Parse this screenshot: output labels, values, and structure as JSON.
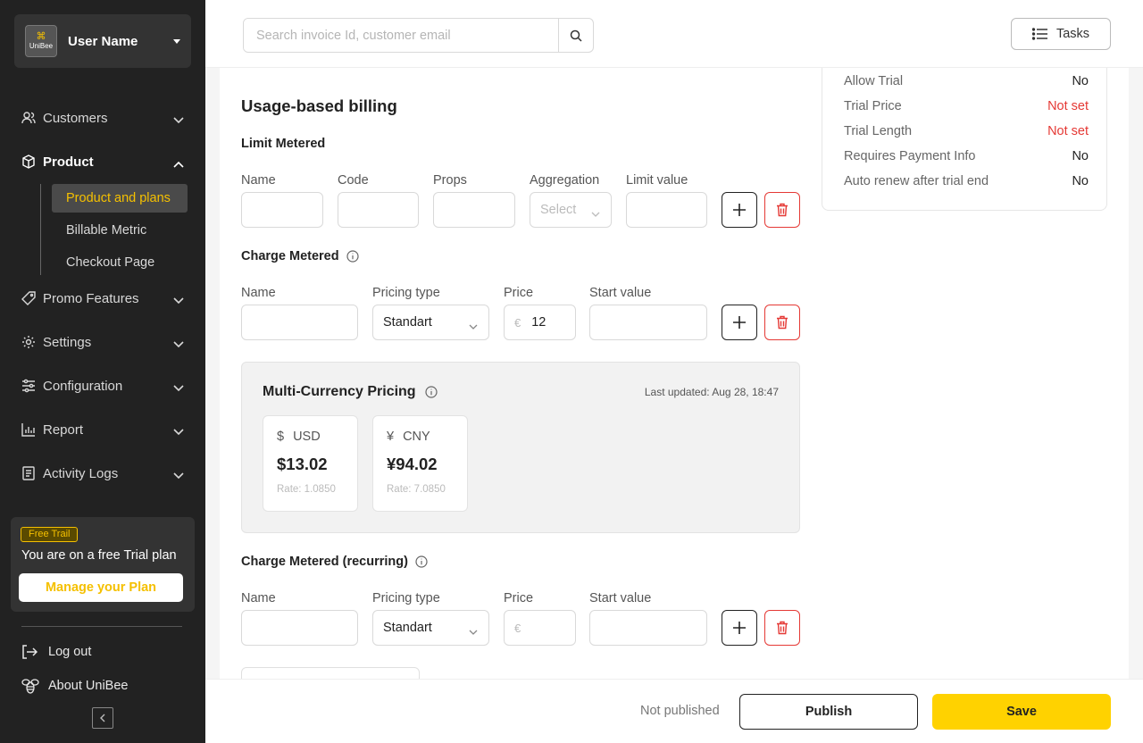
{
  "sidebar": {
    "user": {
      "name": "User Name",
      "logo_text": "UniBee"
    },
    "nav": [
      {
        "label": "Customers",
        "icon": "users-icon"
      },
      {
        "label": "Product",
        "icon": "box-icon"
      },
      {
        "label": "Promo Features",
        "icon": "tag-icon"
      },
      {
        "label": "Settings",
        "icon": "gear-icon"
      },
      {
        "label": "Configuration",
        "icon": "sliders-icon"
      },
      {
        "label": "Report",
        "icon": "bar-chart-icon"
      },
      {
        "label": "Activity Logs",
        "icon": "list-doc-icon"
      }
    ],
    "product_sub": [
      "Product and plans",
      "Billable Metric",
      "Checkout Page"
    ],
    "trial": {
      "badge": "Free Trail",
      "text": "You are on a free Trial plan",
      "button": "Manage your Plan"
    },
    "logout": "Log out",
    "about": "About UniBee"
  },
  "header": {
    "search_placeholder": "Search invoice Id, customer email",
    "tasks_label": "Tasks"
  },
  "main": {
    "section_title": "Usage-based billing",
    "limit_metered": {
      "title": "Limit Metered",
      "labels": [
        "Name",
        "Code",
        "Props",
        "Aggregation",
        "Limit value"
      ],
      "aggregation_placeholder": "Select"
    },
    "charge_metered": {
      "title": "Charge Metered",
      "labels": [
        "Name",
        "Pricing type",
        "Price",
        "Start value"
      ],
      "pricing_type": "Standart",
      "currency_prefix": "€",
      "price": "12"
    },
    "multi_currency": {
      "title": "Multi-Currency Pricing",
      "last_updated": "Last updated: Aug 28, 18:47",
      "currencies": [
        {
          "symbol": "$",
          "code": "USD",
          "value": "$13.02",
          "rate": "Rate: 1.0850"
        },
        {
          "symbol": "¥",
          "code": "CNY",
          "value": "¥94.02",
          "rate": "Rate: 7.0850"
        }
      ]
    },
    "charge_recurring": {
      "title": "Charge Metered (recurring)",
      "labels": [
        "Name",
        "Pricing type",
        "Price",
        "Start value"
      ],
      "pricing_type": "Standart",
      "currency_prefix": "€"
    }
  },
  "details": [
    {
      "key": "Allow Trial",
      "value": "No",
      "color": "#222222"
    },
    {
      "key": "Trial Price",
      "value": "Not set",
      "color": "#e53935"
    },
    {
      "key": "Trial Length",
      "value": "Not set",
      "color": "#e53935"
    },
    {
      "key": "Requires Payment Info",
      "value": "No",
      "color": "#222222"
    },
    {
      "key": "Auto renew after trial end",
      "value": "No",
      "color": "#222222"
    }
  ],
  "footer": {
    "status": "Not published",
    "publish": "Publish",
    "save": "Save"
  },
  "colors": {
    "accent": "#ffd200",
    "danger": "#e53935",
    "sidebar_bg": "#222222"
  }
}
